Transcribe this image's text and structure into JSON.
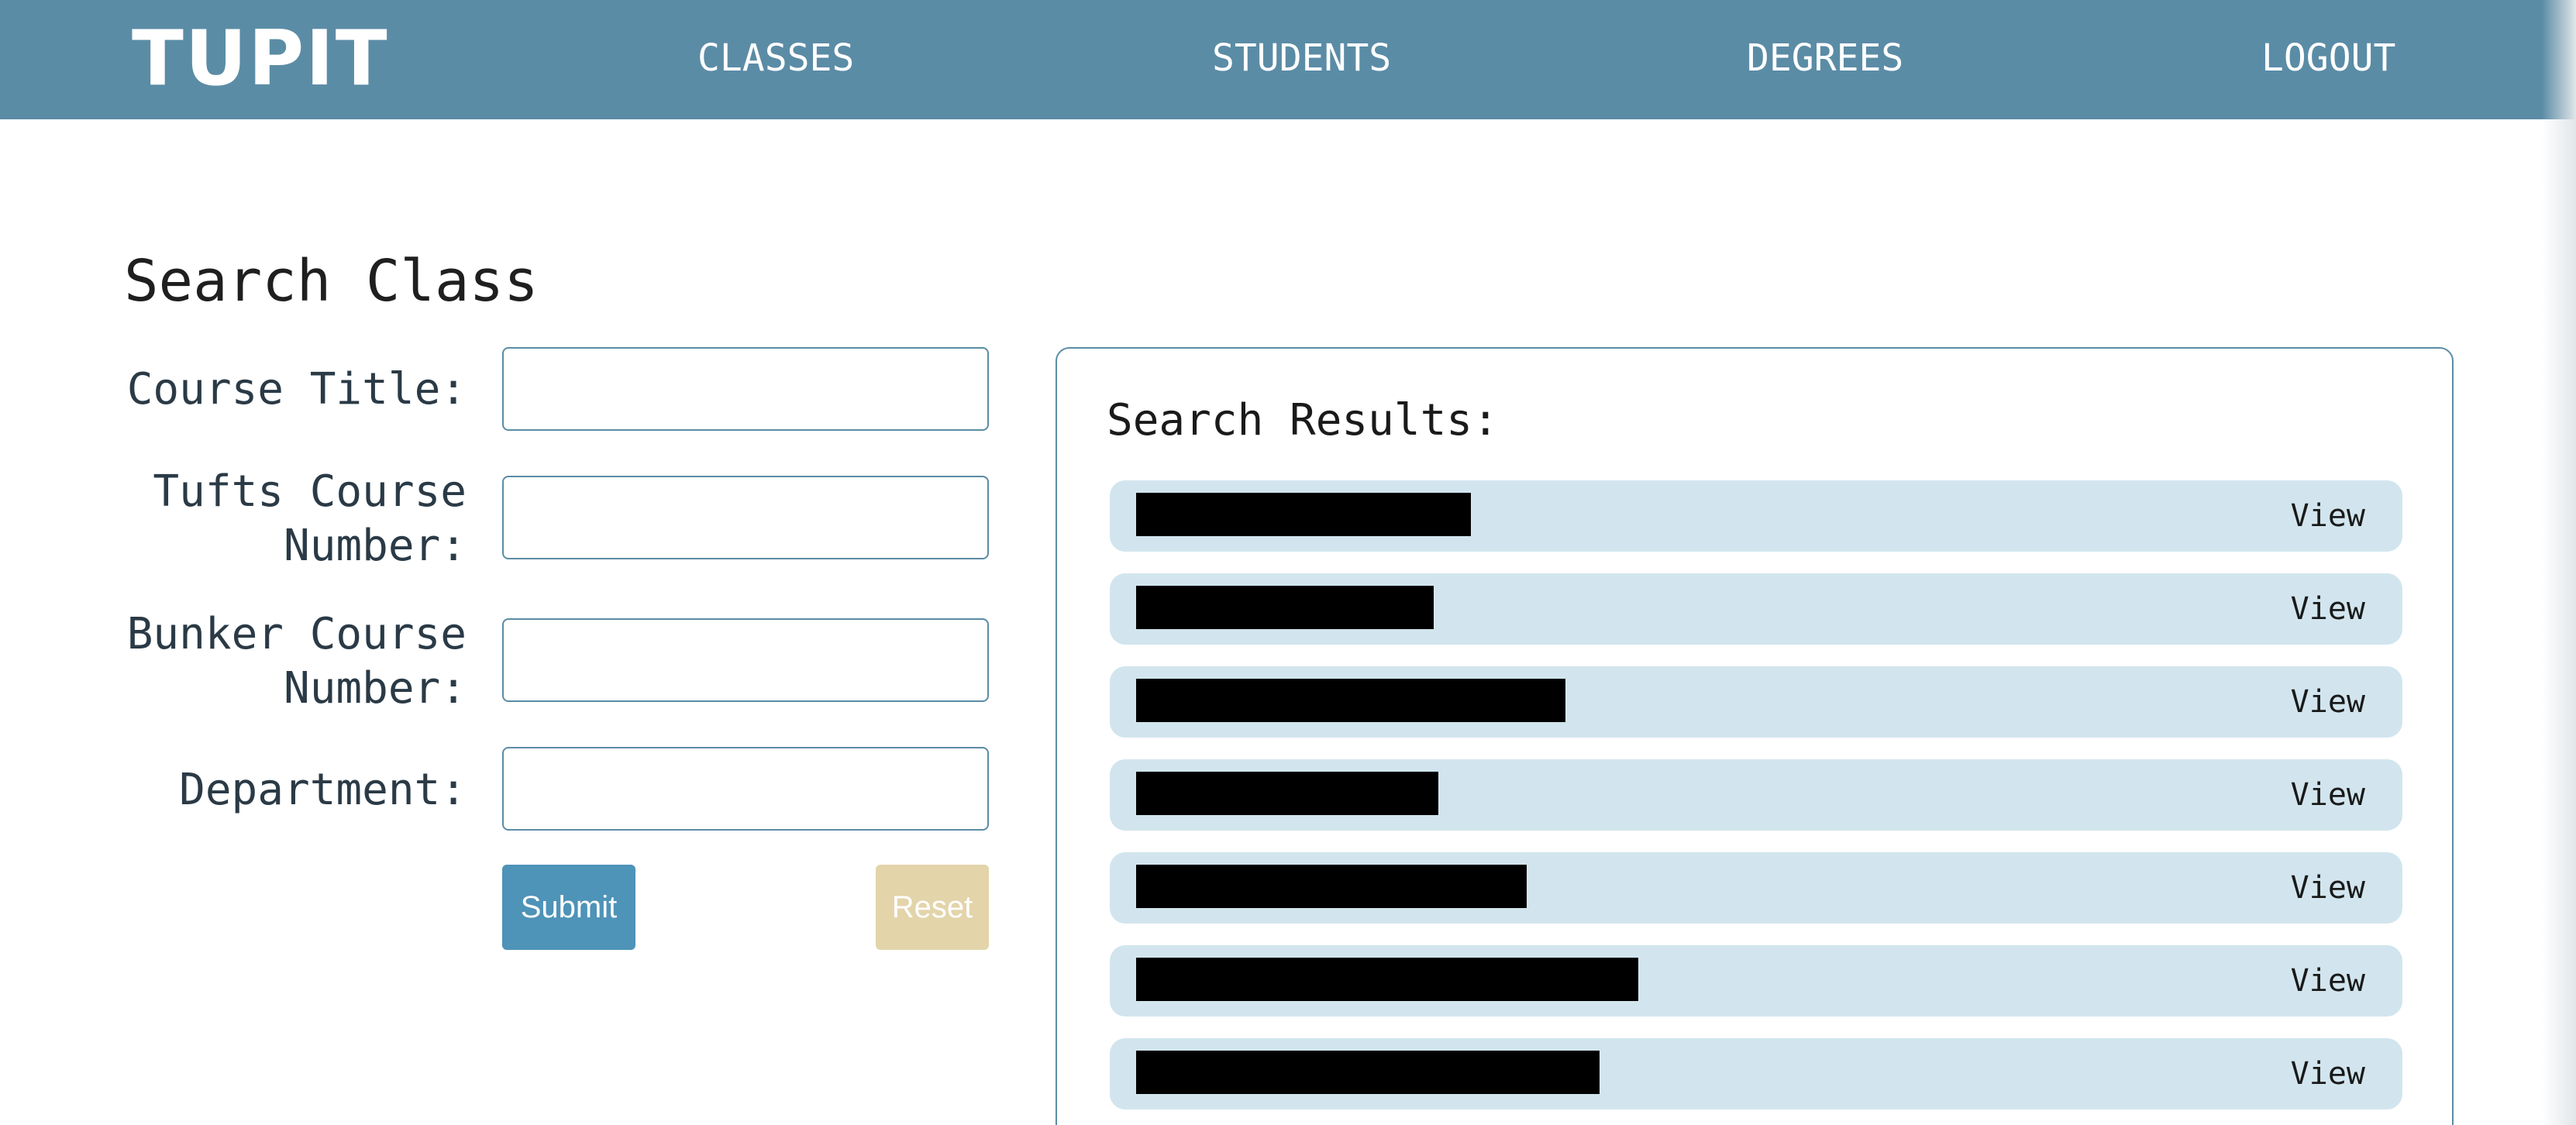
{
  "nav": {
    "brand": "TUPIT",
    "links": {
      "classes": "CLASSES",
      "students": "STUDENTS",
      "degrees": "DEGREES",
      "logout": "LOGOUT"
    }
  },
  "colors": {
    "navbar": "#5b8ca6",
    "submit": "#4e93b8",
    "reset": "#e3d4aa",
    "result_row": "#d2e5ee",
    "border": "#5b8ca6"
  },
  "search": {
    "heading": "Search Class",
    "fields": {
      "course_title": {
        "label": "Course Title:",
        "value": ""
      },
      "tufts_number": {
        "label": "Tufts Course Number:",
        "value": ""
      },
      "bunker_number": {
        "label": "Bunker Course Number:",
        "value": ""
      },
      "department": {
        "label": "Department:",
        "value": ""
      }
    },
    "submit_label": "Submit",
    "reset_label": "Reset"
  },
  "results": {
    "title": "Search Results:",
    "view_label": "View",
    "items": [
      {
        "title": "",
        "redacted": true
      },
      {
        "title": "",
        "redacted": true
      },
      {
        "title": "",
        "redacted": true
      },
      {
        "title": "",
        "redacted": true
      },
      {
        "title": "",
        "redacted": true
      },
      {
        "title": "",
        "redacted": true
      },
      {
        "title": "",
        "redacted": true
      }
    ]
  }
}
